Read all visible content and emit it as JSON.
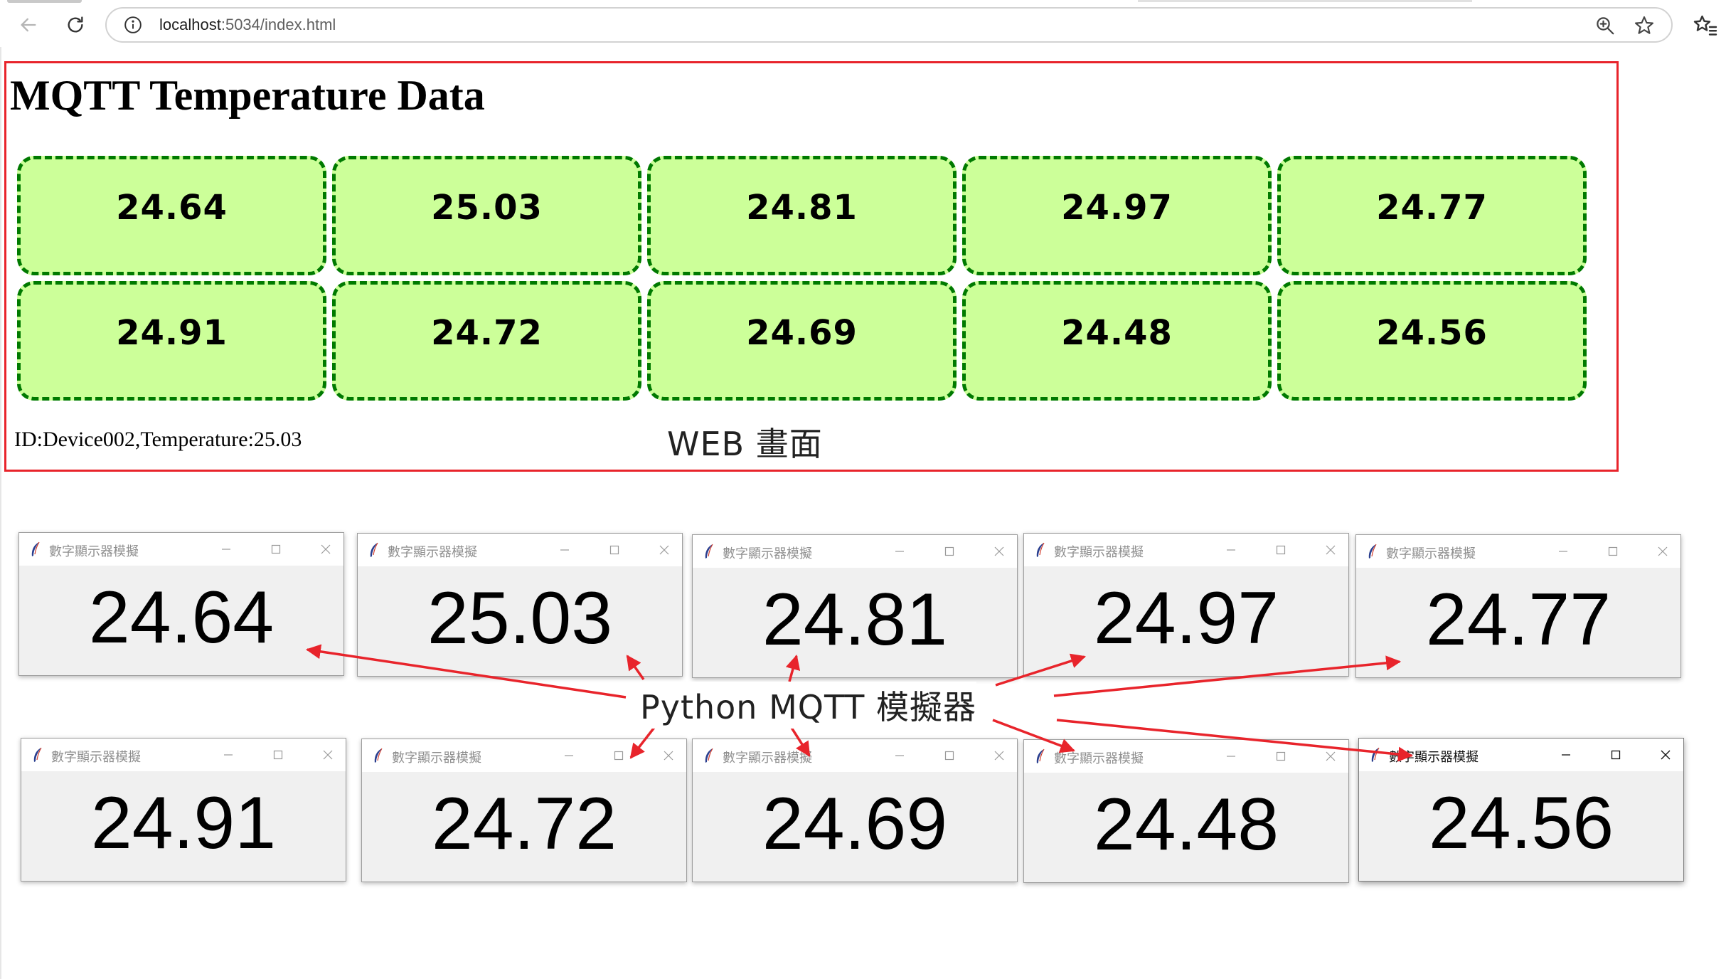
{
  "browser": {
    "url_host": "localhost",
    "url_rest": ":5034/index.html"
  },
  "web": {
    "title": "MQTT Temperature Data",
    "values": [
      "24.64",
      "25.03",
      "24.81",
      "24.97",
      "24.77",
      "24.91",
      "24.72",
      "24.69",
      "24.48",
      "24.56"
    ],
    "status": "ID:Device002,Temperature:25.03",
    "caption": "WEB 畫面"
  },
  "python": {
    "window_title": "數字顯示器模擬",
    "values": [
      "24.64",
      "25.03",
      "24.81",
      "24.97",
      "24.77",
      "24.91",
      "24.72",
      "24.69",
      "24.48",
      "24.56"
    ],
    "caption": "Python MQTT 模擬器"
  },
  "colors": {
    "panel_border": "#e8242b",
    "box_fill": "#ccff99",
    "box_border": "#007a00",
    "arrow": "#e8242b"
  },
  "icons": {
    "back": "arrow-left-icon",
    "reload": "reload-icon",
    "info": "info-icon",
    "zoom": "zoom-icon",
    "star": "star-icon",
    "favorites": "favorites-icon",
    "window": "feather-icon"
  }
}
